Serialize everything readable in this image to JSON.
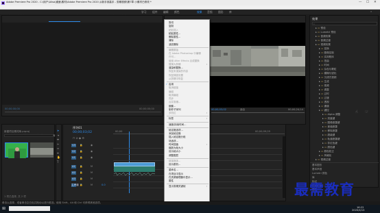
{
  "title_bar": {
    "title": "Adobe Premiere Pro 2020 - C:\\用户\\Alisa\\桌面\\素材\\Adobe Premiere Pro 2020 从新手到高手 - 剪辑视频\\第7章 小素材已修改 *",
    "minimize": "—",
    "maximize": "☐",
    "close": "✕"
  },
  "menu_bar": {
    "items": [
      "文件(F)",
      "编辑(E)",
      "剪辑(C)",
      "序列(S)",
      "标记(M)",
      "图形(G)",
      "视图(V)",
      "窗口(W)",
      "帮助(H)"
    ]
  },
  "workspace_bar": {
    "items": [
      "学习",
      "组件",
      "编辑",
      "颜色",
      "效果",
      "音频",
      "图形",
      "库"
    ],
    "active": "编辑"
  },
  "source_panel": {
    "tabs": [
      "源:(无剪辑)",
      "Lumetri 范围",
      "源:小素材视频.mp4",
      "音频剪辑混合器:剪辑"
    ],
    "timecode_left": "00;00;00;00",
    "timecode_right": "00;00;00;00"
  },
  "program_panel": {
    "timecode_left": "00;00;03;02",
    "fit": "适合",
    "timecode_right": "00;00;24;14"
  },
  "project_panel": {
    "tabs": [
      "项目: 新建项目素材库",
      "媒体浏览器",
      "库"
    ],
    "path": "新建项目素材库.prproj",
    "item_count": "1 项已选择, 共 2 项"
  },
  "timeline_panel": {
    "sequence_tab": "序列01",
    "timecode": "00;00;03;02",
    "ruler_labels": [
      "00;00",
      "00;00;04;29",
      "00;00;09;29"
    ],
    "tracks": [
      {
        "name": "V3"
      },
      {
        "name": "V2"
      },
      {
        "name": "V1"
      },
      {
        "name": "A1"
      },
      {
        "name": "A2"
      },
      {
        "name": "A3"
      },
      {
        "name": "主声道"
      }
    ],
    "master_value": "0.0"
  },
  "effects_panel": {
    "title": "效果",
    "items": [
      {
        "label": "预设",
        "indent": 0
      },
      {
        "label": "Lumetri 预设",
        "indent": 0
      },
      {
        "label": "音频效果",
        "indent": 0
      },
      {
        "label": "音频过渡",
        "indent": 0
      },
      {
        "label": "视频效果",
        "indent": 0
      },
      {
        "label": "变换",
        "indent": 1
      },
      {
        "label": "图像控制",
        "indent": 1
      },
      {
        "label": "实用程序",
        "indent": 1
      },
      {
        "label": "扭曲",
        "indent": 1
      },
      {
        "label": "时间",
        "indent": 1
      },
      {
        "label": "杂色与颗粒",
        "indent": 1
      },
      {
        "label": "模糊与锐化",
        "indent": 1
      },
      {
        "label": "沉浸式视频",
        "indent": 1
      },
      {
        "label": "生成",
        "indent": 1
      },
      {
        "label": "视频",
        "indent": 1
      },
      {
        "label": "调整",
        "indent": 1
      },
      {
        "label": "过时",
        "indent": 1
      },
      {
        "label": "过渡",
        "indent": 1
      },
      {
        "label": "透视",
        "indent": 1
      },
      {
        "label": "通道",
        "indent": 1
      },
      {
        "label": "键控",
        "indent": 1
      },
      {
        "label": "Alpha 调整",
        "indent": 2
      },
      {
        "label": "亮度键",
        "indent": 2
      },
      {
        "label": "图像遮罩键",
        "indent": 2
      },
      {
        "label": "差值遮罩",
        "indent": 2
      },
      {
        "label": "移除遮罩",
        "indent": 2
      },
      {
        "label": "超级键",
        "indent": 2
      },
      {
        "label": "轨道遮罩键",
        "indent": 2
      },
      {
        "label": "非红色键",
        "indent": 2
      },
      {
        "label": "颜色键",
        "indent": 2
      },
      {
        "label": "颜色校正",
        "indent": 1
      },
      {
        "label": "风格化",
        "indent": 1
      },
      {
        "label": "视频过渡",
        "indent": 0
      }
    ],
    "bottom_items": [
      "基本图形",
      "基本声音",
      "Lumetri 颜色",
      "库",
      "标记",
      "历史记录",
      "信息"
    ]
  },
  "context_menu": {
    "items": [
      {
        "label": "剪切",
        "disabled": false
      },
      {
        "label": "复制",
        "disabled": false
      },
      {
        "label": "粘贴插入",
        "disabled": true
      },
      {
        "label": "粘贴属性...",
        "disabled": false
      },
      {
        "label": "删除属性...",
        "disabled": false
      },
      {
        "label": "清除",
        "disabled": false
      },
      {
        "label": "波纹删除",
        "disabled": false
      },
      {
        "sep": true
      },
      {
        "label": "编辑原始",
        "disabled": true
      },
      {
        "label": "在 Adobe Photoshop 中编辑",
        "disabled": true
      },
      {
        "label": "许可...",
        "disabled": true
      },
      {
        "label": "使用 After Effects 合成替换",
        "disabled": true
      },
      {
        "label": "替换为剪辑",
        "disabled": true,
        "submenu": true
      },
      {
        "label": "渲染和替换...",
        "disabled": false
      },
      {
        "label": "恢复未渲染的内容",
        "disabled": true
      },
      {
        "label": "恢复捕捉设置",
        "disabled": true
      },
      {
        "label": "从剪辑中恢复",
        "disabled": true
      },
      {
        "sep": true
      },
      {
        "label": "启用",
        "disabled": false,
        "checked": true
      },
      {
        "label": "取消链接",
        "disabled": true
      },
      {
        "label": "编组",
        "disabled": true
      },
      {
        "label": "取消编组",
        "disabled": true
      },
      {
        "label": "同步",
        "disabled": true
      },
      {
        "label": "合并剪辑...",
        "disabled": true
      },
      {
        "label": "嵌套...",
        "disabled": false
      },
      {
        "label": "制作子序列",
        "disabled": false
      },
      {
        "label": "多机位",
        "disabled": true,
        "submenu": true
      },
      {
        "sep": true
      },
      {
        "label": "标签",
        "disabled": false,
        "submenu": true
      },
      {
        "sep": true
      },
      {
        "label": "速度/持续时间...",
        "disabled": false
      },
      {
        "sep": true
      },
      {
        "label": "帧定格选项...",
        "disabled": false
      },
      {
        "label": "添加帧定格",
        "disabled": false
      },
      {
        "label": "插入帧定格分段",
        "disabled": false
      },
      {
        "label": "场选项...",
        "disabled": false
      },
      {
        "label": "时间插值",
        "disabled": false,
        "submenu": true
      },
      {
        "label": "缩放为帧大小",
        "disabled": false
      },
      {
        "label": "设为帧大小",
        "disabled": false
      },
      {
        "label": "调整图层",
        "disabled": false
      },
      {
        "sep": true
      },
      {
        "label": "链接媒体...",
        "disabled": true
      },
      {
        "label": "设为脱机...",
        "disabled": false
      },
      {
        "sep": true
      },
      {
        "label": "重命名...",
        "disabled": false
      },
      {
        "label": "在项目中显示",
        "disabled": false
      },
      {
        "label": "在资源管理器中显示...",
        "disabled": false
      },
      {
        "label": "属性",
        "disabled": false
      },
      {
        "sep": true
      },
      {
        "label": "显示剪辑关键帧",
        "disabled": false,
        "submenu": true
      }
    ]
  },
  "status_bar": {
    "text": "单击以选择，或者单击空白处并拖动以进行框选。使用 Shift、Alt 和 Ctrl 可获得其他选项。"
  },
  "taskbar": {
    "time": "16:22",
    "date": "2020/4/13"
  },
  "watermark": {
    "text": "最需教育"
  },
  "colors": {
    "accent": "#2d8ceb",
    "clip_video": "#4b9bd6",
    "clip_audio": "#2e7d6f",
    "watermark": "#1a2dbd"
  }
}
